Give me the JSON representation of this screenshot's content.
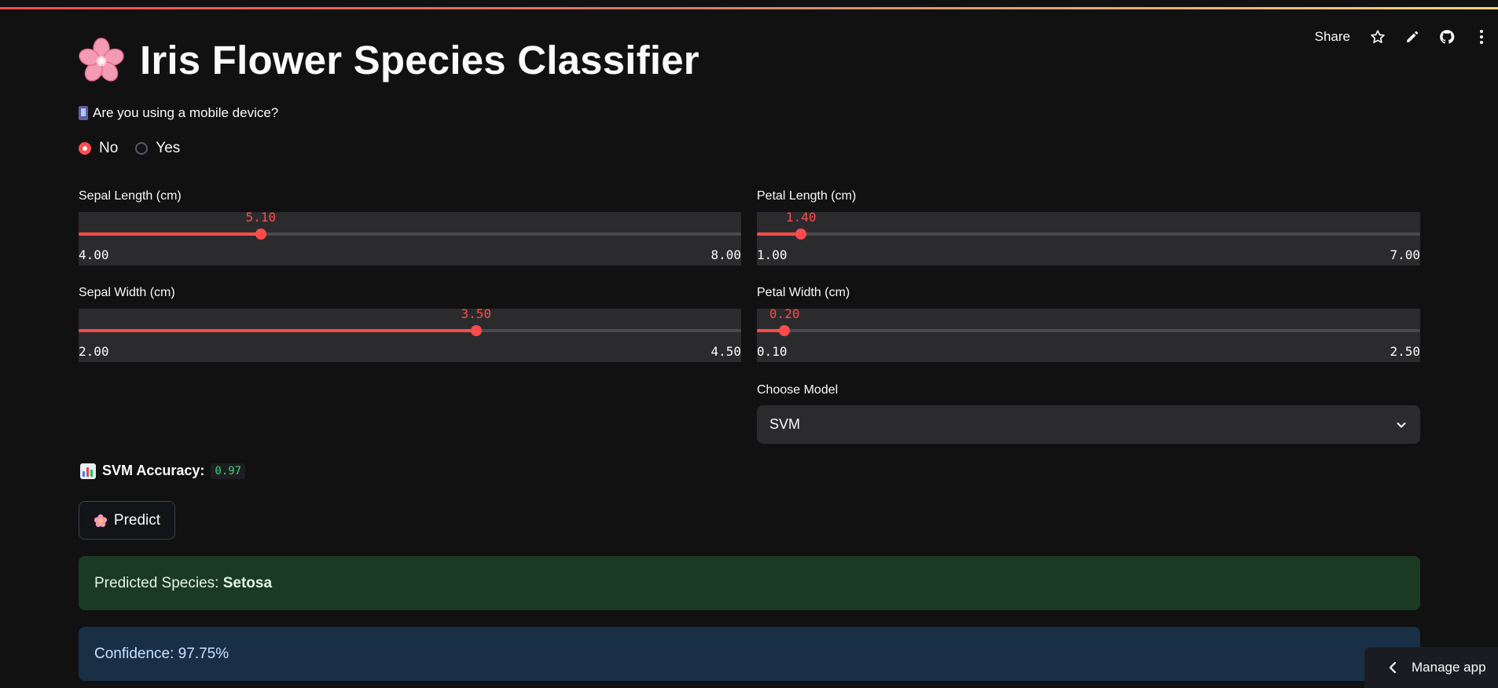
{
  "header": {
    "share_label": "Share",
    "icons": [
      "star-icon",
      "edit-icon",
      "github-icon",
      "more-icon"
    ]
  },
  "title": {
    "emoji": "cherry-blossom-icon",
    "text": "Iris Flower Species Classifier"
  },
  "mobile_question": {
    "label": "Are you using a mobile device?",
    "options": [
      "No",
      "Yes"
    ],
    "selected": "No"
  },
  "sliders": {
    "sepal_length": {
      "label": "Sepal Length (cm)",
      "value": "5.10",
      "min": "4.00",
      "max": "8.00",
      "fraction": 0.275
    },
    "petal_length": {
      "label": "Petal Length (cm)",
      "value": "1.40",
      "min": "1.00",
      "max": "7.00",
      "fraction": 0.0667
    },
    "sepal_width": {
      "label": "Sepal Width (cm)",
      "value": "3.50",
      "min": "2.00",
      "max": "4.50",
      "fraction": 0.6
    },
    "petal_width": {
      "label": "Petal Width (cm)",
      "value": "0.20",
      "min": "0.10",
      "max": "2.50",
      "fraction": 0.0417
    }
  },
  "model_select": {
    "label": "Choose Model",
    "value": "SVM"
  },
  "accuracy": {
    "label": "SVM Accuracy:",
    "value": "0.97"
  },
  "predict_button": {
    "label": "Predict"
  },
  "results": {
    "species_prefix": "Predicted Species: ",
    "species": "Setosa",
    "confidence": "Confidence: 97.75%"
  },
  "manage_app": {
    "label": "Manage app"
  },
  "colors": {
    "accent": "#ff4b4b",
    "success_bg": "#1b3a24",
    "info_bg": "#182f46",
    "accuracy_text": "#3dd56d"
  }
}
